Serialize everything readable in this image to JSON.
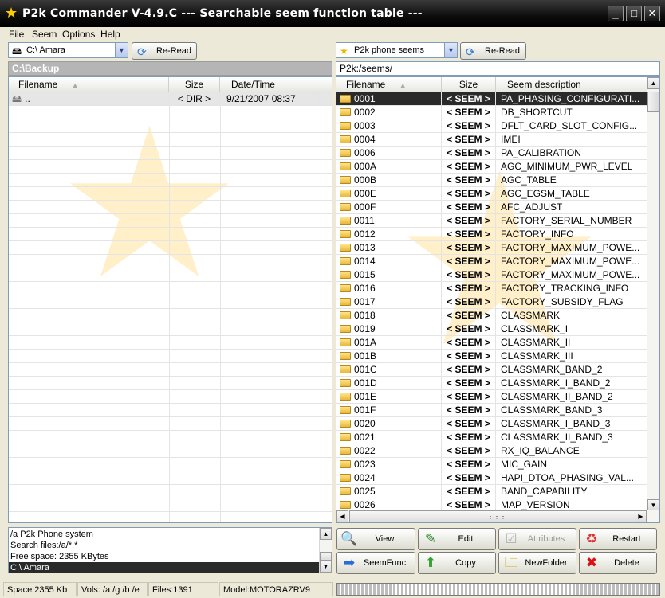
{
  "window": {
    "title": "P2k Commander V-4.9.C  ---  Searchable seem function table  ---",
    "buttons": [
      "_",
      "□",
      "✕"
    ]
  },
  "menu": [
    "File",
    "Seem",
    "Options",
    "Help"
  ],
  "left": {
    "combo": "C:\\ Amara",
    "reread": "Re-Read",
    "path": "C:\\Backup",
    "headers": {
      "name": "Filename",
      "size": "Size",
      "date": "Date/Time"
    },
    "rows": [
      {
        "name": "..",
        "size": "< DIR >",
        "date": "9/21/2007 08:37"
      }
    ]
  },
  "right": {
    "combo": "P2k phone seems",
    "reread": "Re-Read",
    "path": "P2k:/seems/",
    "headers": {
      "name": "Filename",
      "size": "Size",
      "desc": "Seem description"
    },
    "rows": [
      {
        "name": "0001",
        "size": "< SEEM >",
        "desc": "PA_PHASING_CONFIGURATI..."
      },
      {
        "name": "0002",
        "size": "< SEEM >",
        "desc": "DB_SHORTCUT"
      },
      {
        "name": "0003",
        "size": "< SEEM >",
        "desc": "DFLT_CARD_SLOT_CONFIG..."
      },
      {
        "name": "0004",
        "size": "< SEEM >",
        "desc": "IMEI"
      },
      {
        "name": "0006",
        "size": "< SEEM >",
        "desc": "PA_CALIBRATION"
      },
      {
        "name": "000A",
        "size": "< SEEM >",
        "desc": "AGC_MINIMUM_PWR_LEVEL"
      },
      {
        "name": "000B",
        "size": "< SEEM >",
        "desc": "AGC_TABLE"
      },
      {
        "name": "000E",
        "size": "< SEEM >",
        "desc": "AGC_EGSM_TABLE"
      },
      {
        "name": "000F",
        "size": "< SEEM >",
        "desc": "AFC_ADJUST"
      },
      {
        "name": "0011",
        "size": "< SEEM >",
        "desc": "FACTORY_SERIAL_NUMBER"
      },
      {
        "name": "0012",
        "size": "< SEEM >",
        "desc": "FACTORY_INFO"
      },
      {
        "name": "0013",
        "size": "< SEEM >",
        "desc": "FACTORY_MAXIMUM_POWE..."
      },
      {
        "name": "0014",
        "size": "< SEEM >",
        "desc": "FACTORY_MAXIMUM_POWE..."
      },
      {
        "name": "0015",
        "size": "< SEEM >",
        "desc": "FACTORY_MAXIMUM_POWE..."
      },
      {
        "name": "0016",
        "size": "< SEEM >",
        "desc": "FACTORY_TRACKING_INFO"
      },
      {
        "name": "0017",
        "size": "< SEEM >",
        "desc": "FACTORY_SUBSIDY_FLAG"
      },
      {
        "name": "0018",
        "size": "< SEEM >",
        "desc": "CLASSMARK"
      },
      {
        "name": "0019",
        "size": "< SEEM >",
        "desc": "CLASSMARK_I"
      },
      {
        "name": "001A",
        "size": "< SEEM >",
        "desc": "CLASSMARK_II"
      },
      {
        "name": "001B",
        "size": "< SEEM >",
        "desc": "CLASSMARK_III"
      },
      {
        "name": "001C",
        "size": "< SEEM >",
        "desc": "CLASSMARK_BAND_2"
      },
      {
        "name": "001D",
        "size": "< SEEM >",
        "desc": "CLASSMARK_I_BAND_2"
      },
      {
        "name": "001E",
        "size": "< SEEM >",
        "desc": "CLASSMARK_II_BAND_2"
      },
      {
        "name": "001F",
        "size": "< SEEM >",
        "desc": "CLASSMARK_BAND_3"
      },
      {
        "name": "0020",
        "size": "< SEEM >",
        "desc": "CLASSMARK_I_BAND_3"
      },
      {
        "name": "0021",
        "size": "< SEEM >",
        "desc": "CLASSMARK_II_BAND_3"
      },
      {
        "name": "0022",
        "size": "< SEEM >",
        "desc": "RX_IQ_BALANCE"
      },
      {
        "name": "0023",
        "size": "< SEEM >",
        "desc": "MIC_GAIN"
      },
      {
        "name": "0024",
        "size": "< SEEM >",
        "desc": "HAPI_DTOA_PHASING_VAL..."
      },
      {
        "name": "0025",
        "size": "< SEEM >",
        "desc": "BAND_CAPABILITY"
      },
      {
        "name": "0026",
        "size": "< SEEM >",
        "desc": "MAP_VERSION"
      }
    ]
  },
  "log": [
    "/a P2k Phone system",
    "Search files:/a/*.*",
    "Free space: 2355 KBytes",
    "C:\\ Amara"
  ],
  "actions": {
    "view": "View",
    "edit": "Edit",
    "attributes": "Attributes",
    "restart": "Restart",
    "seemfunc": "SeemFunc",
    "copy": "Copy",
    "newfolder": "NewFolder",
    "delete": "Delete"
  },
  "status": {
    "space": "Space:2355 Kb",
    "vols": "Vols: /a /g /b /e",
    "files": "Files:1391",
    "model": "Model:MOTORAZRV9"
  }
}
